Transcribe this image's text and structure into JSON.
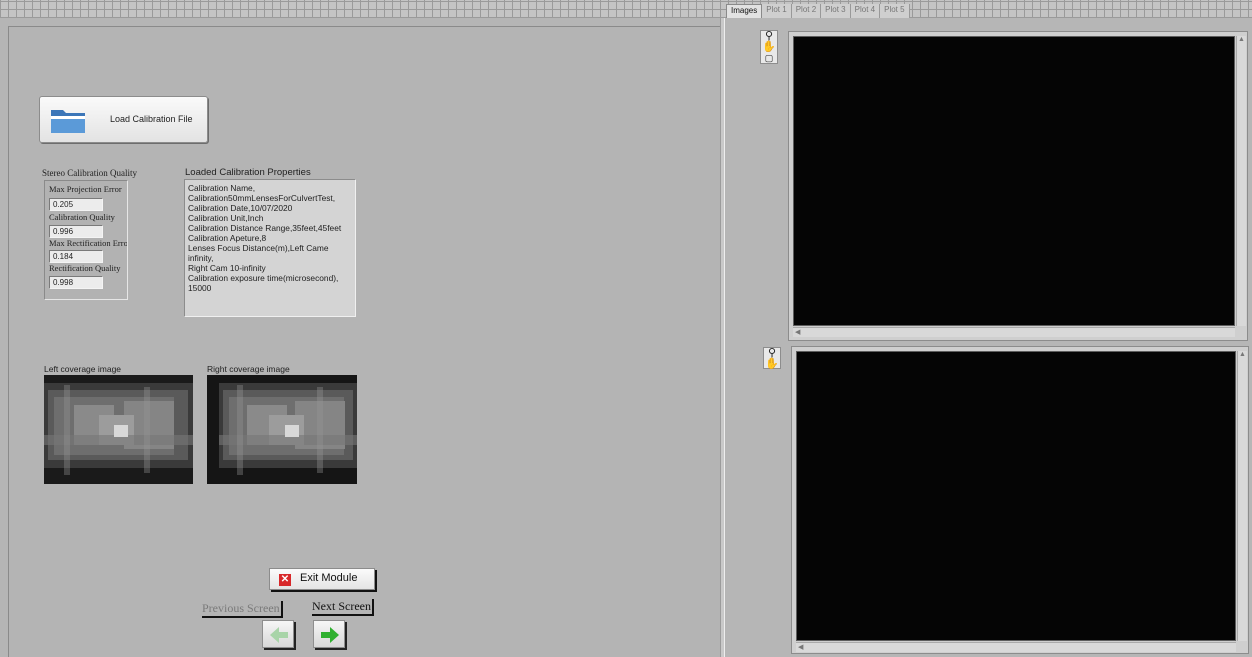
{
  "tabs": [
    "Images",
    "Plot 1",
    "Plot 2",
    "Plot 3",
    "Plot 4",
    "Plot 5"
  ],
  "load_button": {
    "label": "Load Calibration File",
    "icon": "folder-icon"
  },
  "quality": {
    "title": "Stereo Calibration Quality",
    "fields": [
      {
        "label": "Max Projection Error",
        "value": "0.205"
      },
      {
        "label": "Calibration Quality",
        "value": "0.996"
      },
      {
        "label": "Max Rectification Error",
        "value": "0.184"
      },
      {
        "label": "Rectification Quality",
        "value": "0.998"
      }
    ]
  },
  "properties": {
    "title": "Loaded Calibration Properties",
    "lines": [
      "Calibration Name,",
      "Calibration50mmLensesForCulvertTest,",
      "Calibration Date,10/07/2020",
      "Calibration Unit,Inch",
      "Calibration Distance Range,35feet,45feet",
      "Calibration Apeture,8",
      "Lenses Focus Distance(m),Left Came infinity,",
      "Right Cam 10-infinity",
      "Calibration exposure time(microsecond),",
      "15000"
    ]
  },
  "coverage": {
    "left_label": "Left coverage image",
    "right_label": "Right coverage image"
  },
  "exit_button": {
    "label": "Exit Module"
  },
  "nav": {
    "previous_label": "Previous Screen",
    "next_label": "Next Screen"
  },
  "colors": {
    "exit_icon": "#d8282a",
    "next_arrow": "#2fb02f",
    "prev_arrow": "#9fcf9f",
    "folder": "#4a86c8"
  }
}
